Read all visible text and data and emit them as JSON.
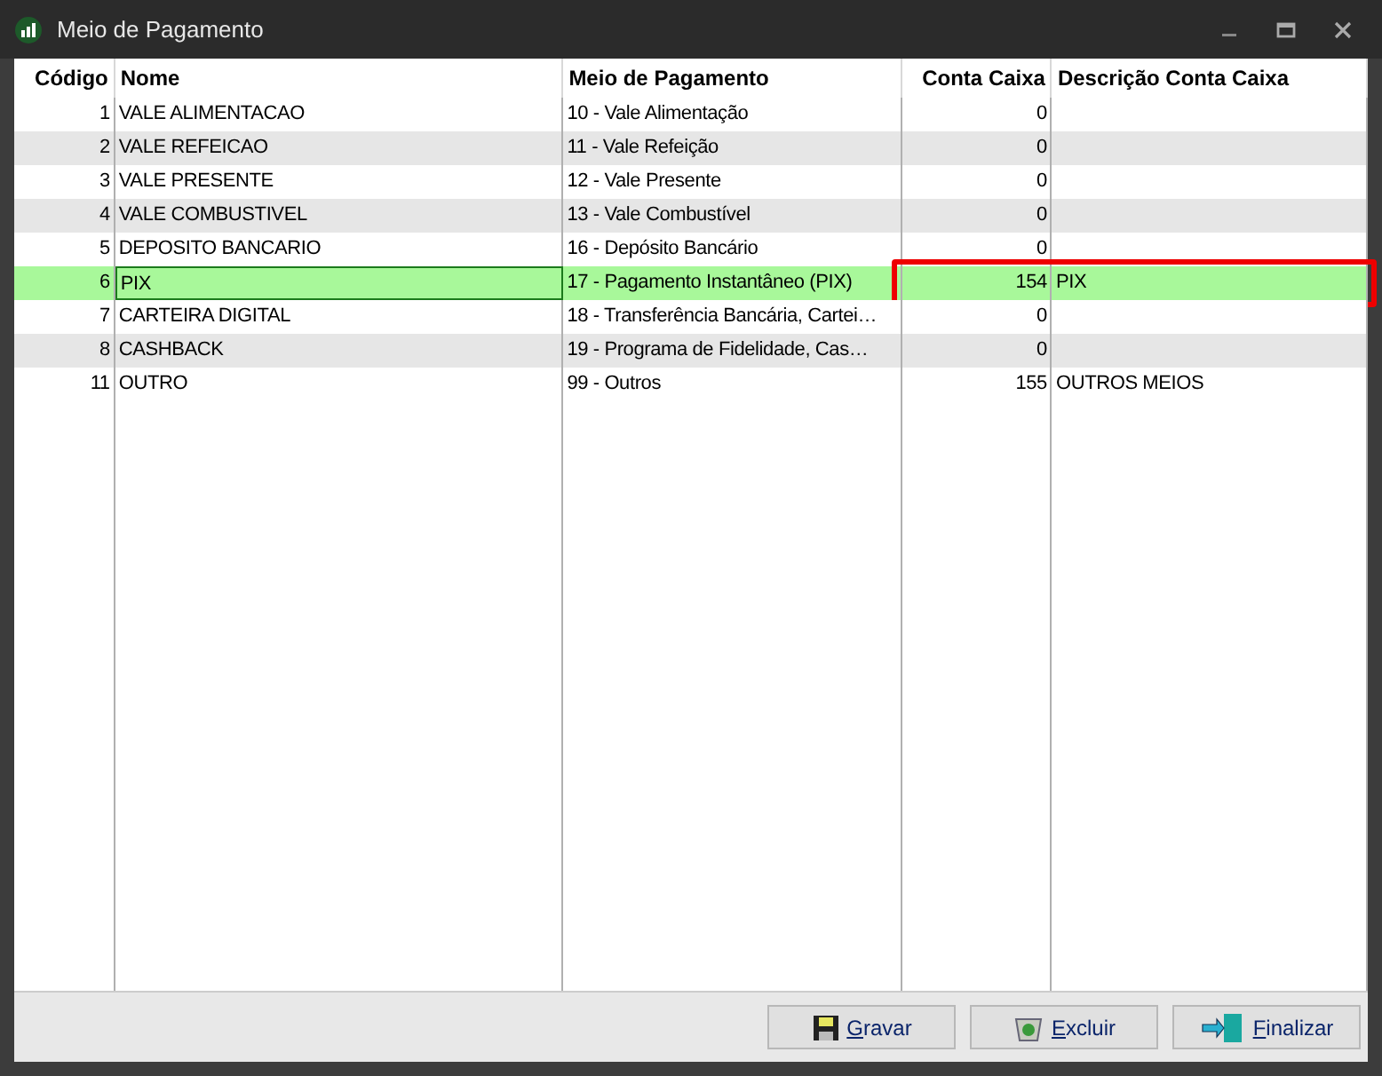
{
  "window": {
    "title": "Meio de Pagamento"
  },
  "table": {
    "columns": [
      {
        "label": "Código"
      },
      {
        "label": "Nome"
      },
      {
        "label": "Meio de Pagamento"
      },
      {
        "label": "Conta Caixa"
      },
      {
        "label": "Descrição Conta Caixa"
      }
    ],
    "rows": [
      {
        "cells": [
          "1",
          "VALE ALIMENTACAO",
          "10 - Vale Alimentação",
          "0",
          ""
        ],
        "selected": false,
        "marked": false
      },
      {
        "cells": [
          "2",
          "VALE REFEICAO",
          "11 - Vale Refeição",
          "0",
          ""
        ],
        "selected": false,
        "marked": false
      },
      {
        "cells": [
          "3",
          "VALE PRESENTE",
          "12 - Vale Presente",
          "0",
          ""
        ],
        "selected": false,
        "marked": false
      },
      {
        "cells": [
          "4",
          "VALE COMBUSTIVEL",
          "13 - Vale Combustível",
          "0",
          ""
        ],
        "selected": false,
        "marked": false
      },
      {
        "cells": [
          "5",
          "DEPOSITO BANCARIO",
          "16 - Depósito Bancário",
          "0",
          ""
        ],
        "selected": false,
        "marked": false
      },
      {
        "cells": [
          "6",
          "PIX",
          "17 - Pagamento Instantâneo (PIX)",
          "154",
          "PIX"
        ],
        "selected": true,
        "marked": true
      },
      {
        "cells": [
          "7",
          "CARTEIRA DIGITAL",
          "18 - Transferência Bancária, Cartei…",
          "0",
          ""
        ],
        "selected": false,
        "marked": false
      },
      {
        "cells": [
          "8",
          "CASHBACK",
          "19 - Programa de Fidelidade, Cas…",
          "0",
          ""
        ],
        "selected": false,
        "marked": false
      },
      {
        "cells": [
          "11",
          "OUTRO",
          "99 - Outros",
          "155",
          "OUTROS MEIOS"
        ],
        "selected": false,
        "marked": false
      }
    ]
  },
  "buttons": [
    {
      "kind": "save",
      "label": "Gravar"
    },
    {
      "kind": "delete",
      "label": "Excluir"
    },
    {
      "kind": "exit",
      "label": "Finalizar"
    }
  ]
}
